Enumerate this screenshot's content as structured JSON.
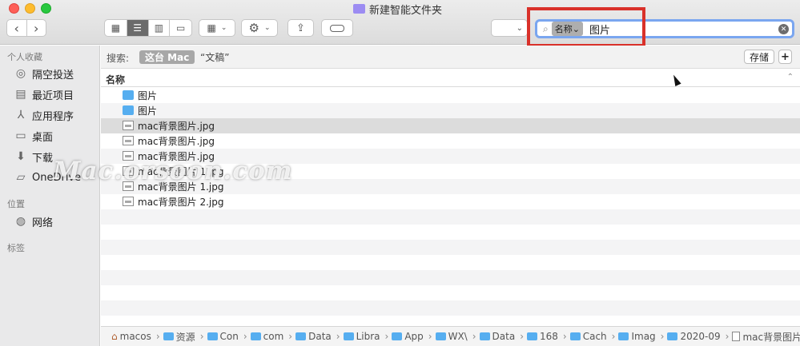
{
  "window": {
    "title": "新建智能文件夹"
  },
  "toolbar": {
    "nav_back": "‹",
    "nav_forward": "›",
    "search_scope_token": "名称⌄",
    "search_text": "图片"
  },
  "sidebar": {
    "favorites_header": "个人收藏",
    "favorites": [
      {
        "label": "隔空投送",
        "icon": "airdrop-icon"
      },
      {
        "label": "最近项目",
        "icon": "recents-icon"
      },
      {
        "label": "应用程序",
        "icon": "applications-icon"
      },
      {
        "label": "桌面",
        "icon": "desktop-icon"
      },
      {
        "label": "下载",
        "icon": "downloads-icon"
      },
      {
        "label": "OneDrive",
        "icon": "folder-icon"
      }
    ],
    "locations_header": "位置",
    "locations": [
      {
        "label": "网络",
        "icon": "network-icon"
      }
    ],
    "tags_header": "标签"
  },
  "scope": {
    "label": "搜索:",
    "this_mac": "这台 Mac",
    "documents": "“文稿”",
    "save": "存储",
    "add": "+"
  },
  "columns": {
    "name": "名称"
  },
  "files": [
    {
      "name": "图片",
      "kind": "folder"
    },
    {
      "name": "图片",
      "kind": "folder"
    },
    {
      "name": "mac背景图片.jpg",
      "kind": "image"
    },
    {
      "name": "mac背景图片.jpg",
      "kind": "image"
    },
    {
      "name": "mac背景图片.jpg",
      "kind": "image"
    },
    {
      "name": "mac背景图片 1.jpg",
      "kind": "image"
    },
    {
      "name": "mac背景图片 1.jpg",
      "kind": "image"
    },
    {
      "name": "mac背景图片 2.jpg",
      "kind": "image"
    }
  ],
  "pathbar": [
    "macos",
    "资源",
    "Con",
    "com",
    "Data",
    "Libra",
    "App",
    "WX\\",
    "Data",
    "168",
    "Cach",
    "Imag",
    "2020-09",
    "mac背景图片.jpg"
  ],
  "watermark": "Mac.orsoon.com",
  "colors": {
    "accent_search_border": "#7aa6f0",
    "highlight_frame": "#d9312a",
    "folder": "#56aef0"
  }
}
